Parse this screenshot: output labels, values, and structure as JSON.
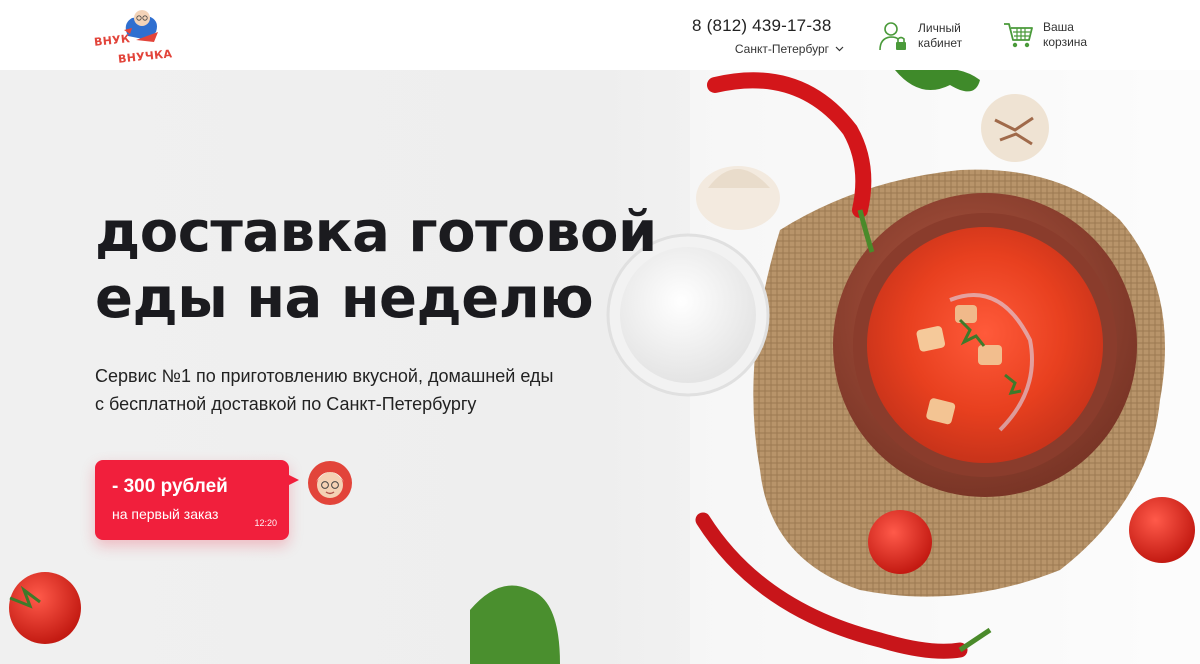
{
  "header": {
    "logo": {
      "line1": "ВНУК",
      "line2": "ВНУЧКА",
      "accent": "#e2443a"
    },
    "phone": "8 (812) 439-17-38",
    "city": "Санкт-Петербург",
    "account": {
      "line1": "Личный",
      "line2": "кабинет",
      "icon": "user-lock-icon"
    },
    "cart": {
      "line1": "Ваша",
      "line2": "корзина",
      "icon": "cart-icon"
    }
  },
  "hero": {
    "title_line1": "доставка готовой",
    "title_line2": "еды на неделю",
    "subtitle_line1": "Сервис №1 по приготовлению вкусной, домашней еды",
    "subtitle_line2": "с бесплатной доставкой по Санкт-Петербургу",
    "promo": {
      "amount": "- 300 рублей",
      "text": "на первый заказ",
      "time": "12:20",
      "color": "#f11f3c"
    }
  },
  "colors": {
    "brand_green": "#4a9a3a",
    "promo_red": "#f11f3c"
  }
}
